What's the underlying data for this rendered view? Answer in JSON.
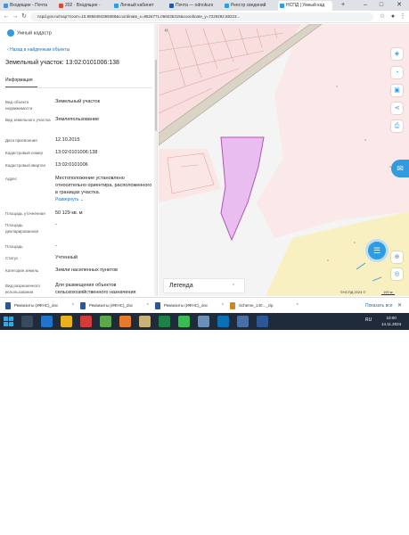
{
  "browser": {
    "tabs": [
      {
        "label": "Входящие - Почта",
        "color": "#4a90d9"
      },
      {
        "label": "202 · Входящие - ",
        "color": "#d84a38"
      },
      {
        "label": "Личный кабинет",
        "color": "#2f9be0"
      },
      {
        "label": "Почта — odnokurs",
        "color": "#1e5aa8"
      },
      {
        "label": "Реестр сведений",
        "color": "#2f9be0"
      },
      {
        "label": "НСПД | Умный кад",
        "color": "#2f9be0"
      }
    ],
    "url": "nspd.gov.ru/map?zoom=15.9858494389388&coordinate_x=8626771.066035315&coordinate_y=7229292.58223...",
    "icons": {
      "back": "back-arrow-icon",
      "forward": "forward-arrow-icon",
      "reload": "reload-icon"
    }
  },
  "panel": {
    "brand": "Умный кадастр",
    "back_link": "Назад в найденным объекты",
    "title": "Земельный участок: 13:02:0101006:138",
    "tab": "Информация",
    "properties": [
      {
        "key": "Вид объекта недвижимости",
        "value": "Земельный участок"
      },
      {
        "key": "Вид земельного участка",
        "value": "Землепользование"
      },
      {
        "key": "Дата присвоения",
        "value": "12.10.2015"
      },
      {
        "key": "Кадастровый номер",
        "value": "13:02:0101006:138"
      },
      {
        "key": "Кадастровый квартал",
        "value": "13:02:0101006"
      },
      {
        "key": "Адрес",
        "value": "Местоположение установлено относительно ориентира, расположенного в границах участка.",
        "more": "Развернуть"
      },
      {
        "key": "Площадь уточненная",
        "value": "50 129 кв. м"
      },
      {
        "key": "Площадь декларированная",
        "value": "-"
      },
      {
        "key": "Площадь",
        "value": "-"
      },
      {
        "key": "Статус",
        "value": "Учтенный"
      },
      {
        "key": "Категория земель",
        "value": "Земли населенных пунктов"
      },
      {
        "key": "Вид разрешенного использования",
        "value": "Для размещения объектов сельскохозяйственного назначения"
      }
    ]
  },
  "map": {
    "legend": "Легенда",
    "credits": "©НСПД 2024 ©",
    "scale": "100 м",
    "parcel_color": "#e9bdf0",
    "parcel_border": "#b255b5",
    "tools": [
      "layers-icon",
      "measure-icon",
      "print-area-icon",
      "share-icon",
      "printer-icon"
    ]
  },
  "downloads": {
    "items": [
      "Реквизиты (ИФНС)_doc",
      "Реквизиты (ИФНС)_doc",
      "Реквизиты (ИФНС)_doc",
      "Scheme_140..._zip"
    ],
    "show_all": "Показать все"
  },
  "taskbar": {
    "lang": "RU",
    "time": "10:00",
    "date": "14.11.2024"
  }
}
